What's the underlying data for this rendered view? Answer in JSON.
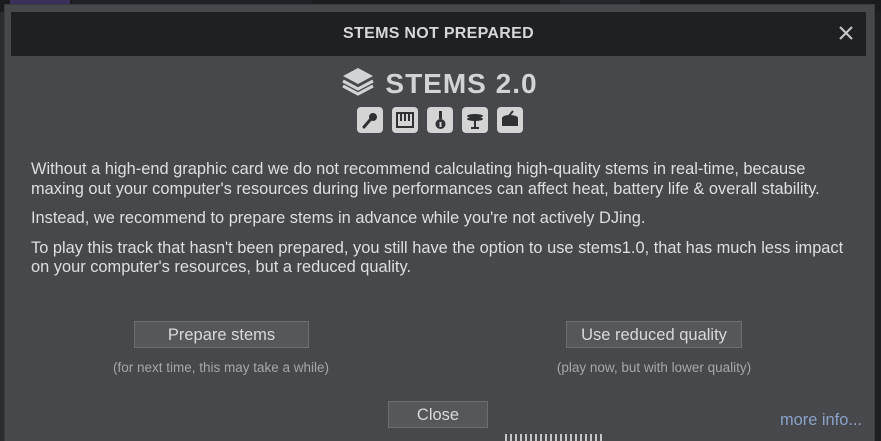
{
  "dialog": {
    "title": "STEMS NOT PREPARED"
  },
  "logo": {
    "text": "STEMS 2.0"
  },
  "stem_icons": [
    "microphone-icon",
    "piano-keys-icon",
    "guitar-icon",
    "hihat-icon",
    "drum-icon"
  ],
  "paragraphs": [
    "Without a high-end graphic card we do not recommend calculating high-quality stems in real-time, because maxing out your computer's resources during live performances can affect heat, battery life & overall stability.",
    "Instead, we recommend to prepare stems in advance while you're not actively DJing.",
    "To play this track that hasn't been prepared, you still have the option to use stems1.0, that has much less impact on your computer's resources, but a reduced quality."
  ],
  "buttons": {
    "prepare": "Prepare stems",
    "prepare_hint": "(for next time, this may take a while)",
    "reduced": "Use reduced quality",
    "reduced_hint": "(play now, but with lower quality)",
    "close": "Close"
  },
  "links": {
    "more_info": "more info..."
  },
  "colors": {
    "dialog_bg": "#47484c",
    "titlebar_bg": "#1f2023",
    "link": "#8aa2c9"
  }
}
